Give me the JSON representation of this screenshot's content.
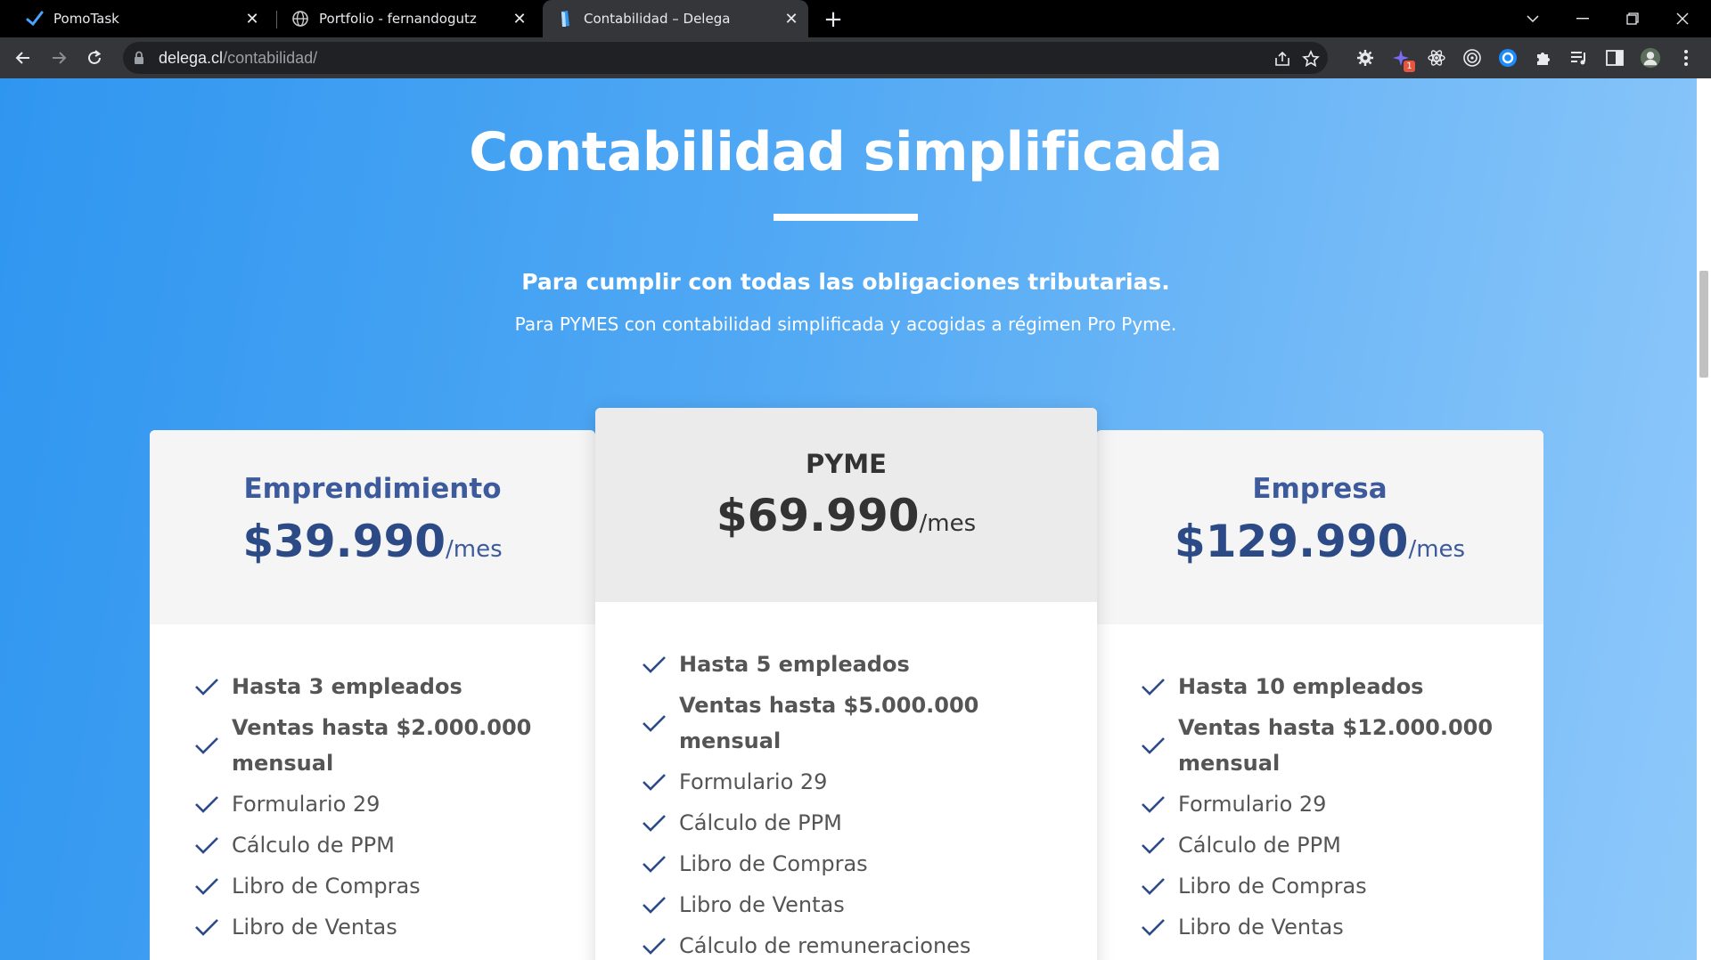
{
  "browser": {
    "tabs": [
      {
        "title": "PomoTask",
        "icon": "check-icon",
        "active": false
      },
      {
        "title": "Portfolio - fernandogutz",
        "icon": "globe-icon",
        "active": false
      },
      {
        "title": "Contabilidad – Delega",
        "icon": "delega-favicon-icon",
        "active": true
      }
    ],
    "url_domain": "delega.cl",
    "url_path": "/contabilidad/"
  },
  "hero": {
    "title": "Contabilidad simplificada",
    "subtitle": "Para cumplir con todas las obligaciones tributarias.",
    "description": "Para PYMES con contabilidad simplificada y acogidas a régimen Pro Pyme."
  },
  "plans": [
    {
      "name": "Emprendimiento",
      "price": "$39.990",
      "period": "/mes",
      "features": [
        {
          "text": "Hasta 3 empleados",
          "bold": true
        },
        {
          "text": "Ventas hasta $2.000.000 mensual",
          "bold": true
        },
        {
          "text": "Formulario 29",
          "bold": false
        },
        {
          "text": "Cálculo de PPM",
          "bold": false
        },
        {
          "text": "Libro de Compras",
          "bold": false
        },
        {
          "text": "Libro de Ventas",
          "bold": false
        }
      ]
    },
    {
      "name": "PYME",
      "price": "$69.990",
      "period": "/mes",
      "features": [
        {
          "text": "Hasta 5 empleados",
          "bold": true
        },
        {
          "text": "Ventas hasta $5.000.000 mensual",
          "bold": true
        },
        {
          "text": "Formulario 29",
          "bold": false
        },
        {
          "text": "Cálculo de PPM",
          "bold": false
        },
        {
          "text": "Libro de Compras",
          "bold": false
        },
        {
          "text": "Libro de Ventas",
          "bold": false
        },
        {
          "text": "Cálculo de remuneraciones",
          "bold": false
        }
      ]
    },
    {
      "name": "Empresa",
      "price": "$129.990",
      "period": "/mes",
      "features": [
        {
          "text": "Hasta 10 empleados",
          "bold": true
        },
        {
          "text": "Ventas hasta $12.000.000 mensual",
          "bold": true
        },
        {
          "text": "Formulario 29",
          "bold": false
        },
        {
          "text": "Cálculo de PPM",
          "bold": false
        },
        {
          "text": "Libro de Compras",
          "bold": false
        },
        {
          "text": "Libro de Ventas",
          "bold": false
        }
      ]
    }
  ],
  "colors": {
    "brand_blue": "#2f96f0",
    "plan_blue": "#3c5a9c",
    "check_blue": "#2c4a86"
  }
}
